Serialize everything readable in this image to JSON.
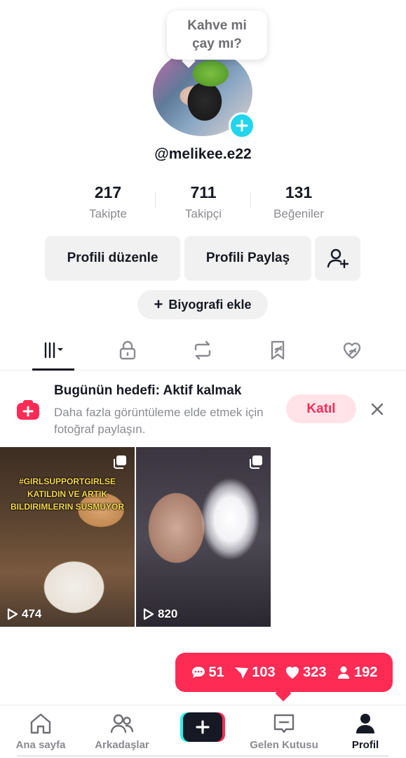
{
  "profile": {
    "note_line1": "Kahve mi",
    "note_line2": "çay mı?",
    "username": "@melikee.e22"
  },
  "stats": [
    {
      "value": "217",
      "label": "Takipte"
    },
    {
      "value": "711",
      "label": "Takipçi"
    },
    {
      "value": "131",
      "label": "Beğeniler"
    }
  ],
  "actions": {
    "edit_profile": "Profili düzenle",
    "share_profile": "Profili Paylaş",
    "add_bio": "Biyografi ekle"
  },
  "tabs": [
    "videos-grid-icon",
    "lock-icon",
    "repost-icon",
    "bookmark-hidden-icon",
    "liked-hidden-icon"
  ],
  "goal": {
    "title": "Bugünün hedefi: Aktif kalmak",
    "description": "Daha fazla görüntüleme elde etmek için fotoğraf paylaşın.",
    "join_label": "Katıl"
  },
  "videos": [
    {
      "caption": "#GIRLSUPPORTGIRLSE KATILDIN VE ARTIK BILDIRIMLERIN SUSMUYOR",
      "views": "474"
    },
    {
      "caption": "",
      "views": "820"
    }
  ],
  "notifications": {
    "comments": "51",
    "shares": "103",
    "likes": "323",
    "followers": "192"
  },
  "nav": {
    "home": "Ana sayfa",
    "friends": "Arkadaşlar",
    "inbox": "Gelen Kutusu",
    "profile": "Profil"
  },
  "colors": {
    "accent": "#fe2c55",
    "cyan": "#25f4ee",
    "avatar_plus": "#20d5ec",
    "text": "#161823",
    "muted": "#8a8b91"
  }
}
